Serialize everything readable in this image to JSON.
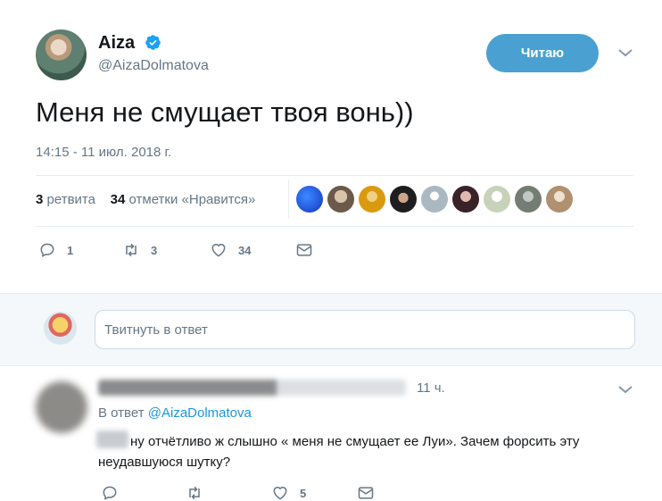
{
  "tweet": {
    "author": {
      "name": "Aiza",
      "handle": "@AizaDolmatova",
      "verified": true
    },
    "follow_button": {
      "label": "Читаю",
      "color": "#4aa1d1"
    },
    "text": "Меня не смущает твоя вонь))",
    "timestamp": "14:15 - 11 июл. 2018 г.",
    "stats": {
      "retweets_count": "3",
      "retweets_label": "ретвита",
      "likes_count": "34",
      "likes_label": "отметки «Нравится»"
    },
    "likers": [
      "#2a56e8",
      "#7a6a5a",
      "#d9a020",
      "#2b2b2b",
      "#aab8c2",
      "#4a2f35",
      "#cfd8c4",
      "#9aa39a",
      "#c8b39a"
    ],
    "actions": {
      "reply_count": "1",
      "retweet_count": "3",
      "like_count": "34"
    }
  },
  "reply_box": {
    "placeholder": "Твитнуть в ответ"
  },
  "reply": {
    "time": "11 ч.",
    "in_reply_prefix": "В ответ",
    "in_reply_handle": "@AizaDolmatova",
    "text": "ну отчётливо ж слышно « меня не смущает ее Луи». Зачем форсить эту неудавшуюся шутку?",
    "actions": {
      "like_count": "5"
    }
  },
  "colors": {
    "accent": "#1b95e0",
    "muted": "#657786"
  }
}
